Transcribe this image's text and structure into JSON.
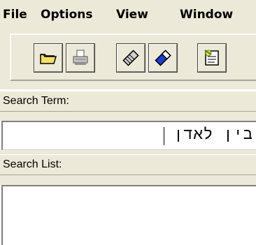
{
  "menubar": {
    "items": [
      {
        "label": "File"
      },
      {
        "label": "Options"
      },
      {
        "label": "View"
      },
      {
        "label": "Window"
      }
    ]
  },
  "toolbar": {
    "buttons": [
      {
        "icon": "open-folder-icon"
      },
      {
        "icon": "print-icon"
      },
      {
        "icon": "eraser-icon"
      },
      {
        "icon": "blue-eraser-icon"
      },
      {
        "icon": "document-wand-icon"
      }
    ]
  },
  "search_term": {
    "label": "Search Term:",
    "value": "בין לאדן"
  },
  "search_list": {
    "label": "Search List:",
    "items": []
  },
  "colors": {
    "chrome": "#ece9d8",
    "field_bg": "#ffffff",
    "shadow": "#808080"
  }
}
